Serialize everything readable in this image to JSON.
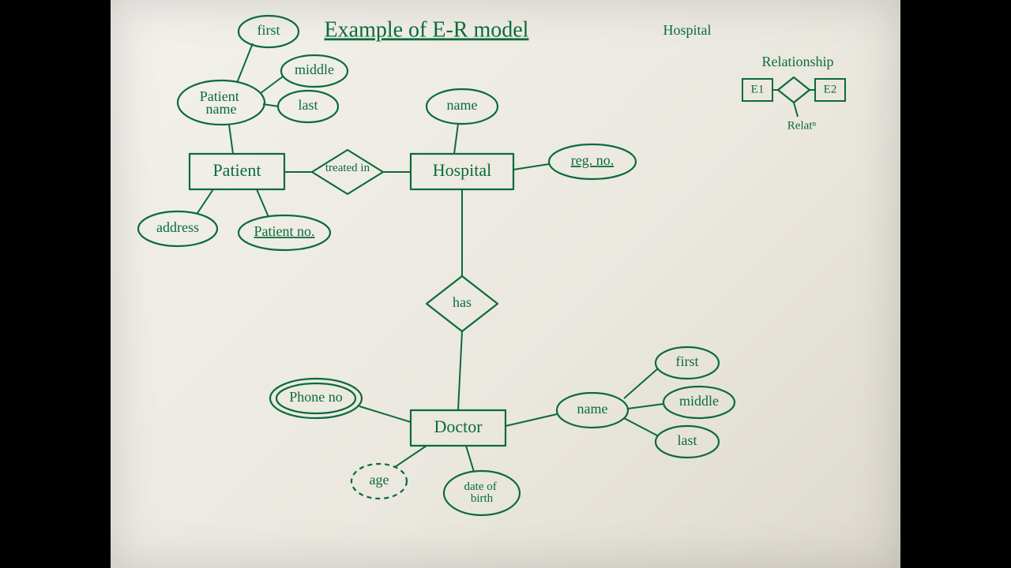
{
  "title": "Example of E-R model",
  "context_label": "Hospital",
  "legend": {
    "heading": "Relationship",
    "e1": "E1",
    "e2": "E2",
    "caption": "Relatⁿ"
  },
  "entities": {
    "patient": "Patient",
    "hospital": "Hospital",
    "doctor": "Doctor"
  },
  "relationships": {
    "treated_in": "treated in",
    "has": "has"
  },
  "attributes": {
    "patient_name": "Patient name",
    "first": "first",
    "middle": "middle",
    "last": "last",
    "address": "address",
    "patient_no": "Patient no.",
    "hospital_name": "name",
    "reg_no": "reg. no.",
    "phone_no": "Phone no",
    "age": "age",
    "date_of_birth": "date of birth",
    "doctor_name": "name",
    "d_first": "first",
    "d_middle": "middle",
    "d_last": "last"
  }
}
